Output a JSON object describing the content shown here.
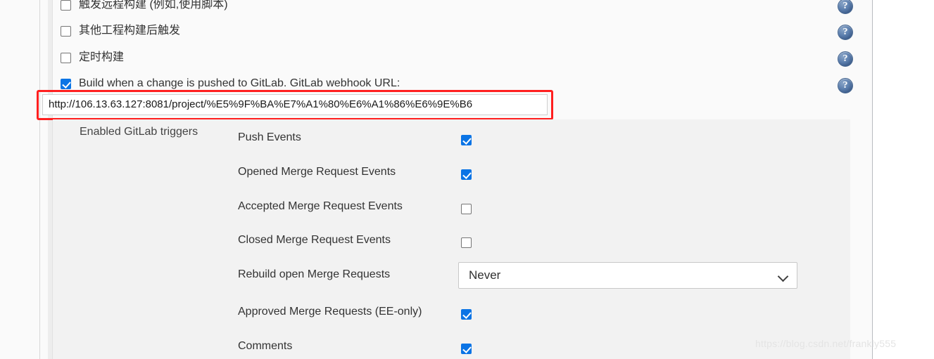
{
  "colors": {
    "accent_checkbox": "#0b74e5",
    "annotation_red": "#ff1f1f",
    "panel_bg": "#f2f2f2",
    "page_bg": "#fafafa",
    "help_icon_blue": "#45658f"
  },
  "build_triggers": [
    {
      "label": "触发远程构建 (例如,使用脚本)",
      "checked": false,
      "icon": "checkbox-icon",
      "help": "help-icon"
    },
    {
      "label": "其他工程构建后触发",
      "checked": false,
      "icon": "checkbox-icon",
      "help": "help-icon"
    },
    {
      "label": "定时构建",
      "checked": false,
      "icon": "checkbox-icon",
      "help": "help-icon"
    },
    {
      "label": "Build when a change is pushed to GitLab. GitLab webhook URL:",
      "checked": true,
      "icon": "checkbox-icon",
      "help": "help-icon"
    }
  ],
  "webhook": {
    "url": "http://106.13.63.127:8081/project/%E5%9F%BA%E7%A1%80%E6%A1%86%E6%9E%B6",
    "readonly": true
  },
  "help_icon_glyph": "?",
  "triggers_section": {
    "label": "Enabled GitLab triggers",
    "options": [
      {
        "label": "Push Events",
        "type": "checkbox",
        "checked": true
      },
      {
        "label": "Opened Merge Request Events",
        "type": "checkbox",
        "checked": true
      },
      {
        "label": "Accepted Merge Request Events",
        "type": "checkbox",
        "checked": false
      },
      {
        "label": "Closed Merge Request Events",
        "type": "checkbox",
        "checked": false
      },
      {
        "label": "Rebuild open Merge Requests",
        "type": "select",
        "value": "Never"
      },
      {
        "label": "Approved Merge Requests (EE-only)",
        "type": "checkbox",
        "checked": true
      },
      {
        "label": "Comments",
        "type": "checkbox",
        "checked": true
      }
    ]
  },
  "watermark": "https://blog.csdn.net/frankly555"
}
